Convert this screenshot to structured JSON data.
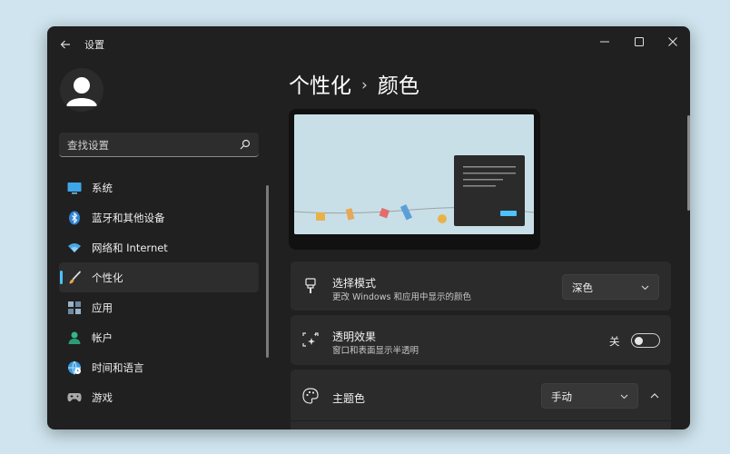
{
  "window": {
    "title": "设置",
    "controls": [
      "minimize-icon",
      "maximize-icon",
      "close-icon"
    ]
  },
  "user": {
    "avatar": "avatar-icon"
  },
  "search": {
    "placeholder": "查找设置",
    "icon": "search-icon"
  },
  "sidebar": {
    "items": [
      {
        "label": "系统",
        "icon": "monitor-icon",
        "active": false
      },
      {
        "label": "蓝牙和其他设备",
        "icon": "bluetooth-icon",
        "active": false
      },
      {
        "label": "网络和 Internet",
        "icon": "wifi-icon",
        "active": false
      },
      {
        "label": "个性化",
        "icon": "brush-icon",
        "active": true
      },
      {
        "label": "应用",
        "icon": "apps-icon",
        "active": false
      },
      {
        "label": "帐户",
        "icon": "account-icon",
        "active": false
      },
      {
        "label": "时间和语言",
        "icon": "globe-clock-icon",
        "active": false
      },
      {
        "label": "游戏",
        "icon": "gamepad-icon",
        "active": false
      }
    ]
  },
  "breadcrumb": {
    "parent": "个性化",
    "separator": "›",
    "current": "颜色"
  },
  "settings": {
    "mode": {
      "title": "选择模式",
      "subtitle": "更改 Windows 和应用中显示的颜色",
      "value": "深色"
    },
    "transparency": {
      "title": "透明效果",
      "subtitle": "窗口和表面显示半透明",
      "state_label": "关",
      "on": false
    },
    "accent": {
      "title": "主题色",
      "value": "手动"
    }
  },
  "colors": {
    "accent": "#4cc2ff",
    "window_bg": "#202020",
    "card_bg": "#2b2b2b"
  }
}
